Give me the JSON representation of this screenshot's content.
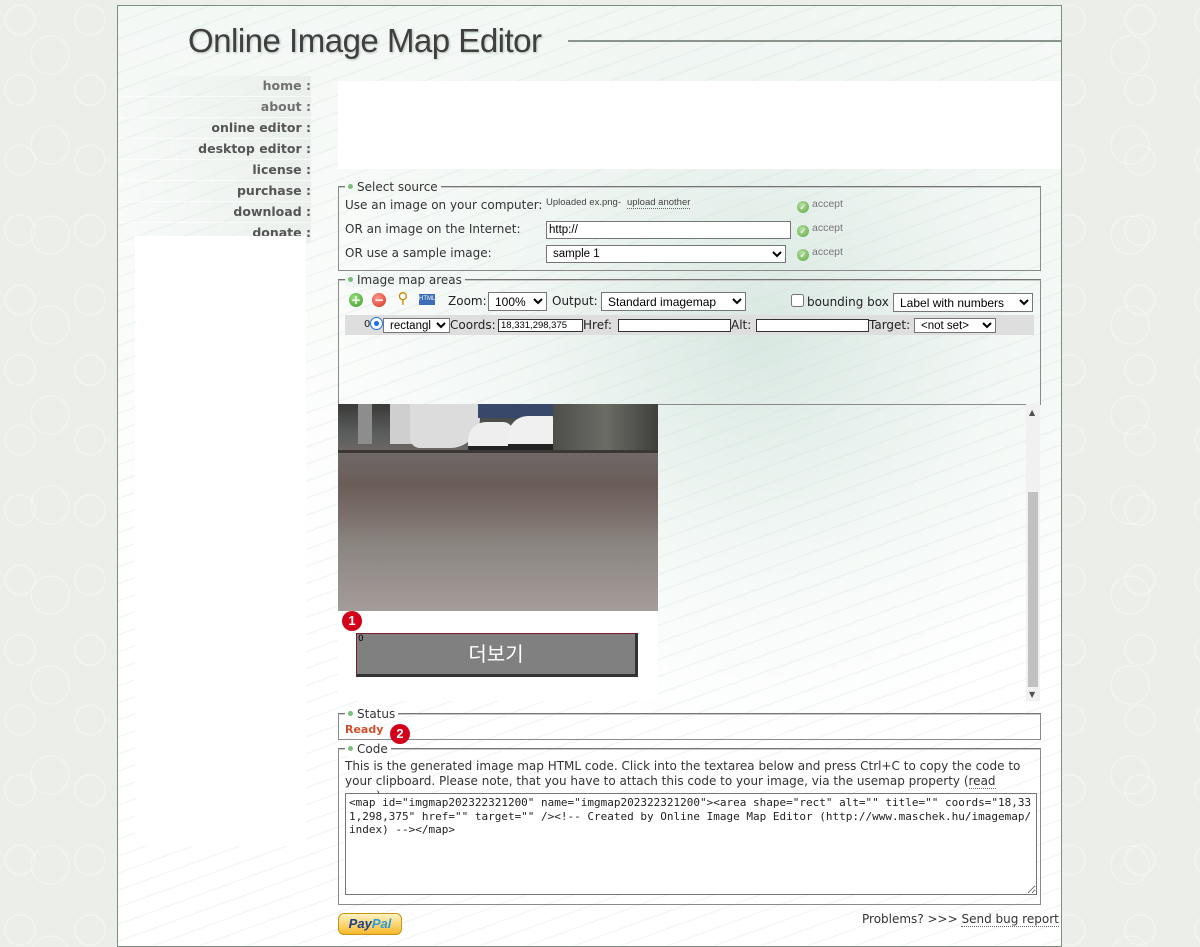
{
  "header": {
    "title": "Online Image Map Editor"
  },
  "nav": {
    "items": [
      "home :",
      "about :",
      "online editor :",
      "desktop editor :",
      "license :",
      "purchase :",
      "download :",
      "donate :"
    ]
  },
  "source": {
    "legend": "Select source",
    "computer_label": "Use an image on your computer:",
    "upload_status": "Uploaded ex.png-",
    "upload_another": "upload another",
    "internet_label": "OR an image on the Internet:",
    "internet_value": "http://",
    "sample_label": "OR use a sample image:",
    "sample_value": "sample 1",
    "accept_label": "accept"
  },
  "areas": {
    "legend": "Image map areas",
    "zoom_label": "Zoom:",
    "zoom_value": "100%",
    "output_label": "Output:",
    "output_value": "Standard imagemap",
    "bounding_box_label": "bounding box",
    "label_mode": "Label with numbers",
    "row": {
      "index": "0",
      "shape": "rectangle",
      "coords_label": "Coords:",
      "coords_value": "18,331,298,375",
      "href_label": "Href:",
      "href_value": "",
      "alt_label": "Alt:",
      "alt_value": "",
      "target_label": "Target:",
      "target_value": "<not set>"
    },
    "icons": [
      "add-icon",
      "remove-icon",
      "preview-icon",
      "html-icon"
    ]
  },
  "canvas": {
    "button_text": "더보기",
    "area_number": "0",
    "badge_1": "1",
    "badge_2": "2"
  },
  "status": {
    "legend": "Status",
    "text": "Ready"
  },
  "code": {
    "legend": "Code",
    "desc_1": "This is the generated image map HTML code. Click into the textarea below and press Ctrl+C to copy the code to your clipboard. Please note, that you have to attach this code to your image, via the usemap property (",
    "read_more": "read more",
    "desc_2": ").",
    "content": "<map id=\"imgmap202322321200\" name=\"imgmap202322321200\"><area shape=\"rect\" alt=\"\" title=\"\" coords=\"18,331,298,375\" href=\"\" target=\"\" /><!-- Created by Online Image Map Editor (http://www.maschek.hu/imagemap/index) --></map>"
  },
  "footer": {
    "paypal_1": "Pay",
    "paypal_2": "Pal",
    "problems": "Problems? >>> ",
    "bug_report": "Send bug report"
  },
  "colors": {
    "status_ready": "#d0502c",
    "accent_green": "#7bbd7b",
    "button_grey": "#808080"
  }
}
